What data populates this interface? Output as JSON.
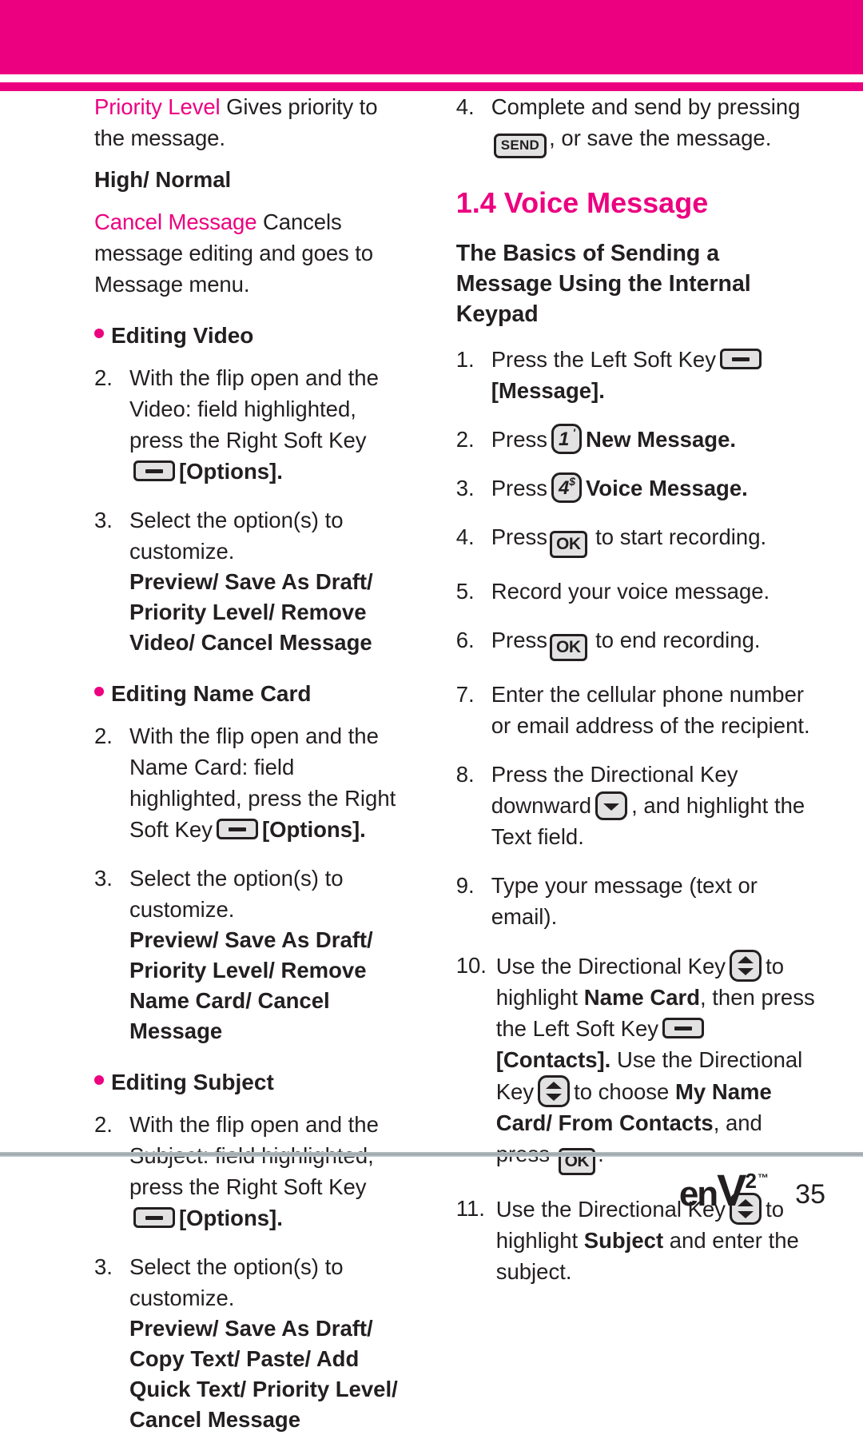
{
  "theme": {
    "accent": "#ec0080",
    "text": "#231f20",
    "key_fill": "#e2e2e2",
    "rule": "#9aa5a9"
  },
  "header": {
    "band_label": "magenta-header-band",
    "rule_label": "magenta-header-rule"
  },
  "left_column": {
    "priority_level": {
      "term": "Priority Level",
      "definition": "Gives priority to the message.",
      "options": "High/ Normal"
    },
    "cancel_message": {
      "term": "Cancel Message",
      "definition": "Cancels message editing and goes to Message menu."
    },
    "editing_video": {
      "heading": "Editing Video",
      "step2_num": "2.",
      "step2_a": "With the flip open and the Video: field highlighted, press the Right Soft Key",
      "step2_b": "[Options].",
      "step3_num": "3.",
      "step3_text": "Select the option(s) to customize.",
      "step3_options": "Preview/ Save As Draft/ Priority Level/ Remove Video/ Cancel Message"
    },
    "editing_name_card": {
      "heading": "Editing Name Card",
      "step2_num": "2.",
      "step2_a": "With the flip open and the Name Card: field highlighted, press the Right Soft Key",
      "step2_b": "[Options].",
      "step3_num": "3.",
      "step3_text": "Select the option(s) to customize.",
      "step3_options": "Preview/ Save As Draft/ Priority Level/ Remove Name Card/ Cancel Message"
    },
    "editing_subject": {
      "heading": "Editing Subject",
      "step2_num": "2.",
      "step2_a": "With the flip open and the Subject: field highlighted, press the Right Soft Key",
      "step2_b": "[Options].",
      "step3_num": "3.",
      "step3_text": "Select the option(s) to customize.",
      "step3_options": "Preview/ Save As Draft/ Copy Text/ Paste/ Add Quick Text/ Priority Level/ Cancel Message"
    }
  },
  "right_column": {
    "step4_prev": {
      "num": "4.",
      "text_a": "Complete and send by pressing",
      "key_label": "SEND",
      "text_b": ", or save the message."
    },
    "section": {
      "title": "1.4 Voice Message",
      "subtitle": "The Basics of Sending a Message Using the Internal Keypad"
    },
    "steps": [
      {
        "num": "1.",
        "a": "Press the Left Soft Key",
        "b": "[Message].",
        "key": "soft"
      },
      {
        "num": "2.",
        "a": "Press",
        "b": "New Message.",
        "key": "num1",
        "digit": "1",
        "sup": "'"
      },
      {
        "num": "3.",
        "a": "Press",
        "b": "Voice Message.",
        "key": "num4",
        "digit": "4",
        "sup": "$"
      },
      {
        "num": "4.",
        "a": "Press",
        "b": "to start recording.",
        "key": "ok",
        "key_label": "OK"
      },
      {
        "num": "5.",
        "a": "Record your voice message."
      },
      {
        "num": "6.",
        "a": "Press",
        "b": "to end recording.",
        "key": "ok",
        "key_label": "OK"
      },
      {
        "num": "7.",
        "a": "Enter the cellular phone number or email address of the recipient."
      },
      {
        "num": "8.",
        "a": "Press the Directional Key downward",
        "b": ", and highlight the Text field.",
        "key": "dir-down"
      },
      {
        "num": "9.",
        "a": "Type your message (text or email)."
      },
      {
        "num": "10.",
        "p1": "Use the Directional Key",
        "p2": "to highlight",
        "p3": "Name Card",
        "p4": ", then press the Left Soft Key",
        "p5": "[Contacts].",
        "p6": "Use the Directional Key",
        "p7": "to choose",
        "p8": "My Name Card/ From Contacts",
        "p9": ", and press",
        "key_label": "OK",
        "period": "."
      },
      {
        "num": "11.",
        "p1": "Use the Directional Key",
        "p2": "to highlight",
        "p3": "Subject",
        "p4": "and enter the subject."
      }
    ]
  },
  "footer": {
    "logo_en": "en",
    "logo_v": "V",
    "logo_2": "2",
    "logo_tm": "™",
    "page_number": "35"
  }
}
